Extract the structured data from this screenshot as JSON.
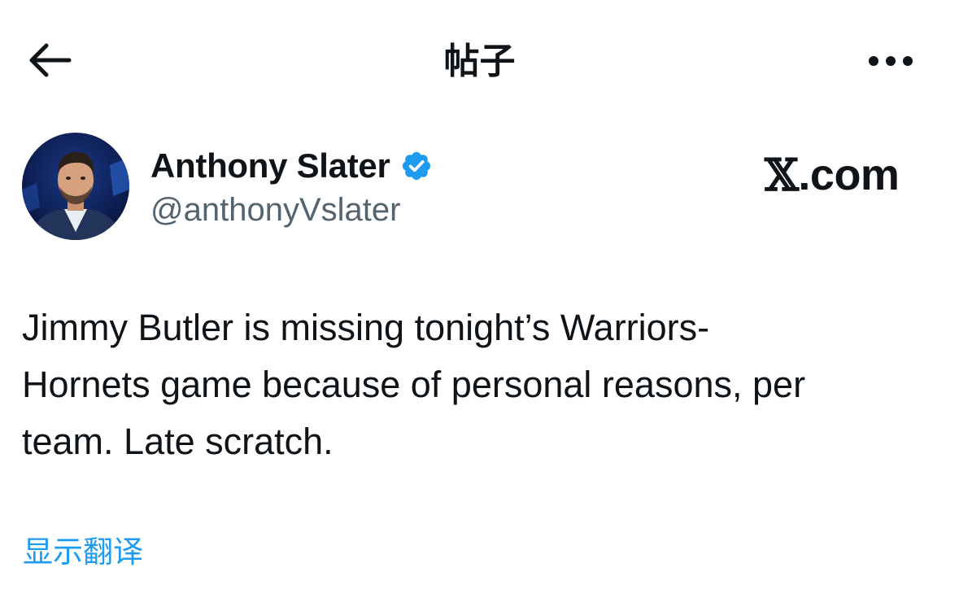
{
  "header": {
    "title": "帖子",
    "back_icon": "arrow-left-icon",
    "more_icon": "more-horizontal-icon"
  },
  "author": {
    "name": "Anthony Slater",
    "handle": "@anthonyVslater",
    "verified": true,
    "verified_color": "#1d9bf0"
  },
  "watermark": {
    "x_symbol": "𝕏",
    "suffix": ".com"
  },
  "tweet": {
    "lines": [
      "Jimmy Butler is missing tonight’s Warriors-",
      "Hornets game because of personal reasons, per",
      "team. Late scratch."
    ]
  },
  "translate_label": "显示翻译",
  "colors": {
    "text": "#0f1419",
    "secondary": "#536471",
    "accent": "#1d9bf0",
    "background": "#ffffff"
  }
}
